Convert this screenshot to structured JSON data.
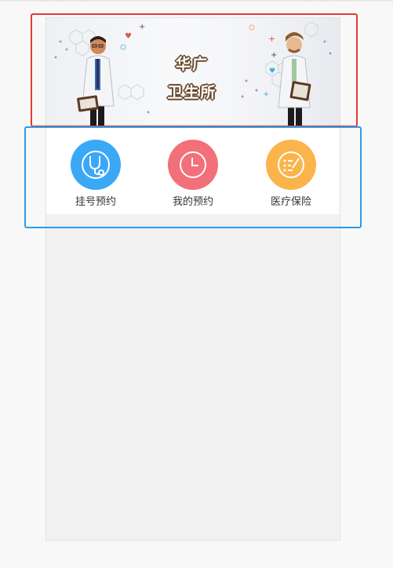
{
  "banner": {
    "title_line1": "华广",
    "title_line2": "卫生所"
  },
  "menu": {
    "items": [
      {
        "label": "挂号预约",
        "icon": "stethoscope-icon",
        "color": "#3aa8f5"
      },
      {
        "label": "我的预约",
        "icon": "clock-icon",
        "color": "#f2707a"
      },
      {
        "label": "医疗保险",
        "icon": "checklist-icon",
        "color": "#fbb44c"
      }
    ]
  },
  "colors": {
    "highlight_red": "#e53935",
    "highlight_blue": "#2b9be8"
  }
}
